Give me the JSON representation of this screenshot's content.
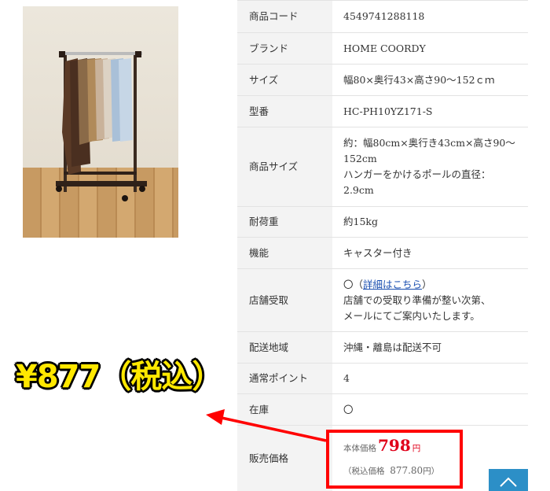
{
  "specs": [
    {
      "label": "商品コード",
      "value": "4549741288118"
    },
    {
      "label": "ブランド",
      "value": "HOME COORDY"
    },
    {
      "label": "サイズ",
      "value": "幅80×奥行43×高さ90〜152ｃｍ"
    },
    {
      "label": "型番",
      "value": "HC-PH10YZ171-S"
    },
    {
      "label": "商品サイズ",
      "lines": [
        "約：幅80cm×奥行き43cm×高さ90〜",
        "152cm",
        "ハンガーをかけるポールの直径：",
        "2.9cm"
      ]
    },
    {
      "label": "耐荷重",
      "value": "約15kg"
    },
    {
      "label": "機能",
      "value": "キャスター付き"
    },
    {
      "label": "店舗受取",
      "circle": "〇（",
      "link": "詳細はこちら",
      "close": "）",
      "lines": [
        "店舗での受取り準備が整い次第、",
        "メールにてご案内いたします。"
      ]
    },
    {
      "label": "配送地域",
      "value": "沖縄・離島は配送不可"
    },
    {
      "label": "通常ポイント",
      "value": "4"
    },
    {
      "label": "在庫",
      "value": "〇"
    }
  ],
  "price": {
    "label": "販売価格",
    "base_label": "本体価格",
    "base_value": "798",
    "base_unit": "円",
    "tax_open": "（税込価格",
    "tax_value": "877.80",
    "tax_unit": "円）"
  },
  "callout": "¥877（税込）",
  "colors": {
    "accent_red": "#e0001a",
    "callout_yellow": "#ffe800",
    "scroll_button": "#2c8fc7"
  }
}
